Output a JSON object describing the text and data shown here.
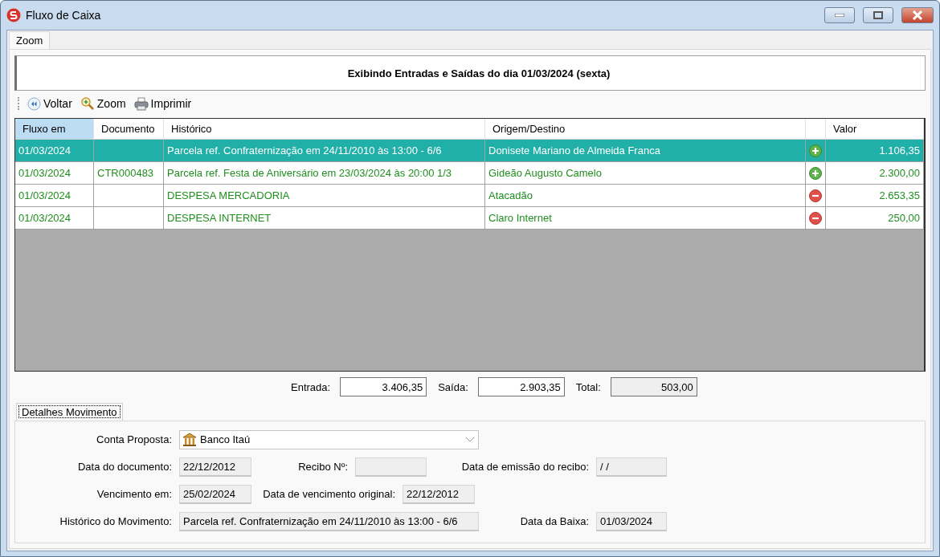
{
  "window": {
    "title": "Fluxo de Caixa"
  },
  "tabs": [
    {
      "label": "Zoom",
      "selected": true
    }
  ],
  "header": {
    "title": "Exibindo Entradas e Saídas do dia 01/03/2024 (sexta)"
  },
  "toolbar": [
    {
      "kind": "back",
      "label": "Voltar"
    },
    {
      "kind": "zoom",
      "label": "Zoom"
    },
    {
      "kind": "print",
      "label": "Imprimir"
    }
  ],
  "table": {
    "columns": [
      {
        "label": "Fluxo em",
        "selected": true
      },
      {
        "label": "Documento",
        "selected": false
      },
      {
        "label": "Histórico",
        "selected": false
      },
      {
        "label": "Origem/Destino",
        "selected": false
      },
      {
        "label": "Valor",
        "selected": false
      }
    ],
    "rows": [
      {
        "selected": true,
        "date": "01/03/2024",
        "document": "",
        "history": "Parcela ref. Confraternização em 24/11/2010 às 13:00 - 6/6",
        "party": "Donisete Mariano de Almeida Franca",
        "kind": "income",
        "value": "1.106,35"
      },
      {
        "selected": false,
        "date": "01/03/2024",
        "document": "CTR000483",
        "history": "Parcela ref. Festa de Aniversário em 23/03/2024 às 20:00 1/3",
        "party": "Gideão Augusto Camelo",
        "kind": "income",
        "value": "2.300,00"
      },
      {
        "selected": false,
        "date": "01/03/2024",
        "document": "",
        "history": "DESPESA MERCADORIA",
        "party": "Atacadão",
        "kind": "expense",
        "value": "2.653,35"
      },
      {
        "selected": false,
        "date": "01/03/2024",
        "document": "",
        "history": "DESPESA INTERNET",
        "party": "Claro Internet",
        "kind": "expense",
        "value": "250,00"
      }
    ]
  },
  "totals": {
    "entrada": {
      "label": "Entrada:",
      "value": "3.406,35"
    },
    "saida": {
      "label": "Saída:",
      "value": "2.903,35"
    },
    "total": {
      "label": "Total:",
      "value": "503,00"
    }
  },
  "detail_tabs": [
    {
      "label": "Detalhes Movimento",
      "selected": true
    }
  ],
  "details": {
    "account": {
      "label": "Conta Proposta:",
      "value": "Banco Itaú"
    },
    "document_date": {
      "label": "Data do documento:",
      "value": "22/12/2012"
    },
    "receipt_no": {
      "label": "Recibo Nº:"
    },
    "receipt_issue_date": {
      "label": "Data de emissão do recibo:",
      "value": "/ /"
    },
    "due_date": {
      "label": "Vencimento em:",
      "value": "25/02/2024"
    },
    "original_due_date": {
      "label": "Data de vencimento original:",
      "value": "22/12/2012"
    },
    "history": {
      "label": "Histórico do Movimento:",
      "value": "Parcela ref. Confraternização em 24/11/2010 às 13:00 - 6/6"
    },
    "settlement_date": {
      "label": "Data da Baixa:",
      "value": "01/03/2024"
    }
  }
}
